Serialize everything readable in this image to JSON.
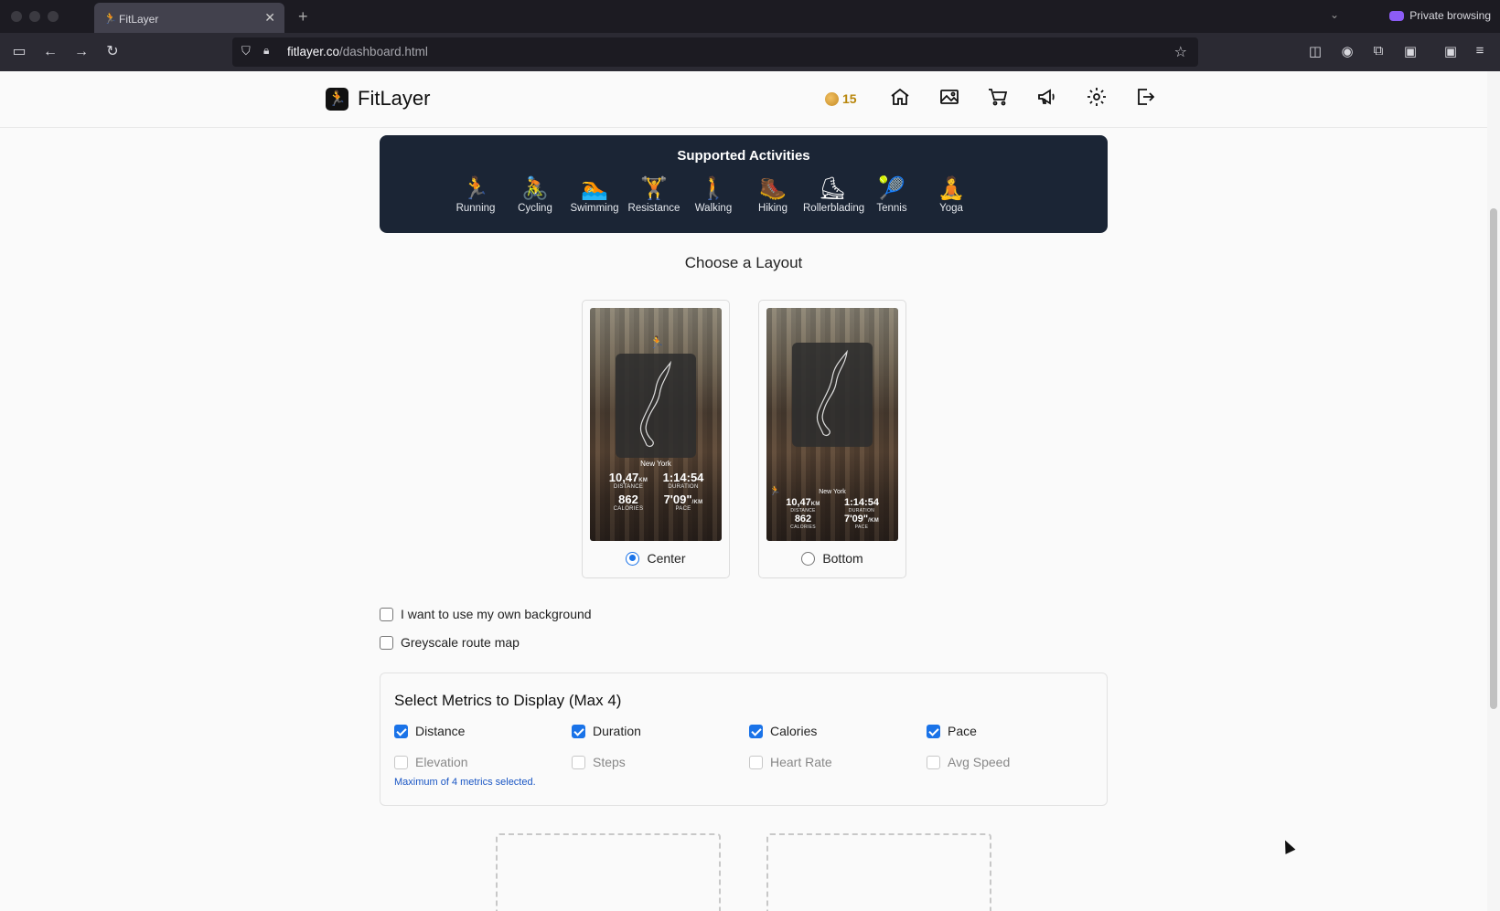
{
  "browser": {
    "tab_title": "FitLayer",
    "url_host": "fitlayer.co",
    "url_path": "/dashboard.html",
    "private_label": "Private browsing"
  },
  "header": {
    "brand": "FitLayer",
    "coins": "15",
    "nav_icons": [
      "home-icon",
      "gallery-icon",
      "cart-icon",
      "megaphone-icon",
      "settings-icon",
      "logout-icon"
    ]
  },
  "activities": {
    "title": "Supported Activities",
    "items": [
      {
        "label": "Running",
        "glyph": "🏃"
      },
      {
        "label": "Cycling",
        "glyph": "🚴"
      },
      {
        "label": "Swimming",
        "glyph": "🏊"
      },
      {
        "label": "Resistance",
        "glyph": "🏋"
      },
      {
        "label": "Walking",
        "glyph": "🚶"
      },
      {
        "label": "Hiking",
        "glyph": "🥾"
      },
      {
        "label": "Rollerblading",
        "glyph": "⛸"
      },
      {
        "label": "Tennis",
        "glyph": "🎾"
      },
      {
        "label": "Yoga",
        "glyph": "🧘"
      }
    ]
  },
  "layout": {
    "title": "Choose a Layout",
    "options": [
      {
        "label": "Center",
        "selected": true
      },
      {
        "label": "Bottom",
        "selected": false
      }
    ],
    "preview": {
      "city": "New York",
      "distance": "10,47",
      "distance_unit": "KM",
      "distance_label": "DISTANCE",
      "duration": "1:14:54",
      "duration_label": "DURATION",
      "calories": "862",
      "calories_label": "CALORIES",
      "pace": "7'09\"",
      "pace_unit": "/KM",
      "pace_label": "PACE"
    }
  },
  "options": {
    "own_background": "I want to use my own background",
    "greyscale": "Greyscale route map"
  },
  "metrics": {
    "title": "Select Metrics to Display (Max 4)",
    "items": [
      {
        "label": "Distance",
        "checked": true,
        "disabled": false
      },
      {
        "label": "Duration",
        "checked": true,
        "disabled": false
      },
      {
        "label": "Calories",
        "checked": true,
        "disabled": false
      },
      {
        "label": "Pace",
        "checked": true,
        "disabled": false
      },
      {
        "label": "Elevation",
        "checked": false,
        "disabled": true
      },
      {
        "label": "Steps",
        "checked": false,
        "disabled": true
      },
      {
        "label": "Heart Rate",
        "checked": false,
        "disabled": true
      },
      {
        "label": "Avg Speed",
        "checked": false,
        "disabled": true
      }
    ],
    "note": "Maximum of 4 metrics selected."
  },
  "colors": {
    "accent": "#1a73e8",
    "banner_bg": "#1b2535",
    "coin": "#b8860b"
  }
}
